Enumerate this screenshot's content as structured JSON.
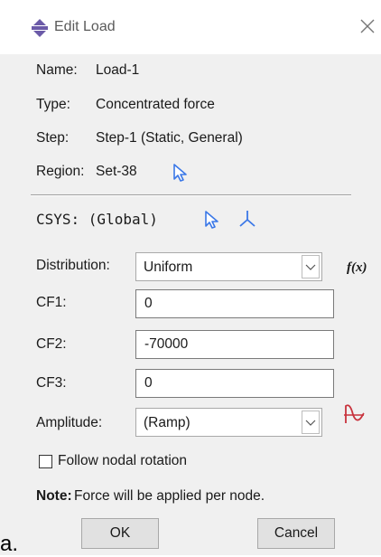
{
  "window": {
    "title": "Edit Load",
    "icon": "load-icon",
    "close_glyph": "×"
  },
  "info": {
    "name_label": "Name:",
    "name_value": "Load-1",
    "type_label": "Type:",
    "type_value": "Concentrated force",
    "step_label": "Step:",
    "step_value": "Step-1 (Static, General)",
    "region_label": "Region:",
    "region_value": "Set-38"
  },
  "csys": {
    "label": "CSYS: (Global)"
  },
  "distribution": {
    "label": "Distribution:",
    "value": "Uniform",
    "fx_label": "f(x)"
  },
  "cf1": {
    "label": "CF1:",
    "value": "0"
  },
  "cf2": {
    "label": "CF2:",
    "value": "-70000"
  },
  "cf3": {
    "label": "CF3:",
    "value": "0"
  },
  "amplitude": {
    "label": "Amplitude:",
    "value": "(Ramp)"
  },
  "follow_nodal": {
    "label": "Follow nodal rotation",
    "checked": false
  },
  "note": {
    "bold": "Note:",
    "text": "Force will be applied per node."
  },
  "buttons": {
    "ok": "OK",
    "cancel": "Cancel"
  },
  "caption": "a.",
  "colors": {
    "accent_blue": "#3b78e7",
    "amp_red": "#c8323c",
    "dialog_bg": "#f0f0f0"
  }
}
